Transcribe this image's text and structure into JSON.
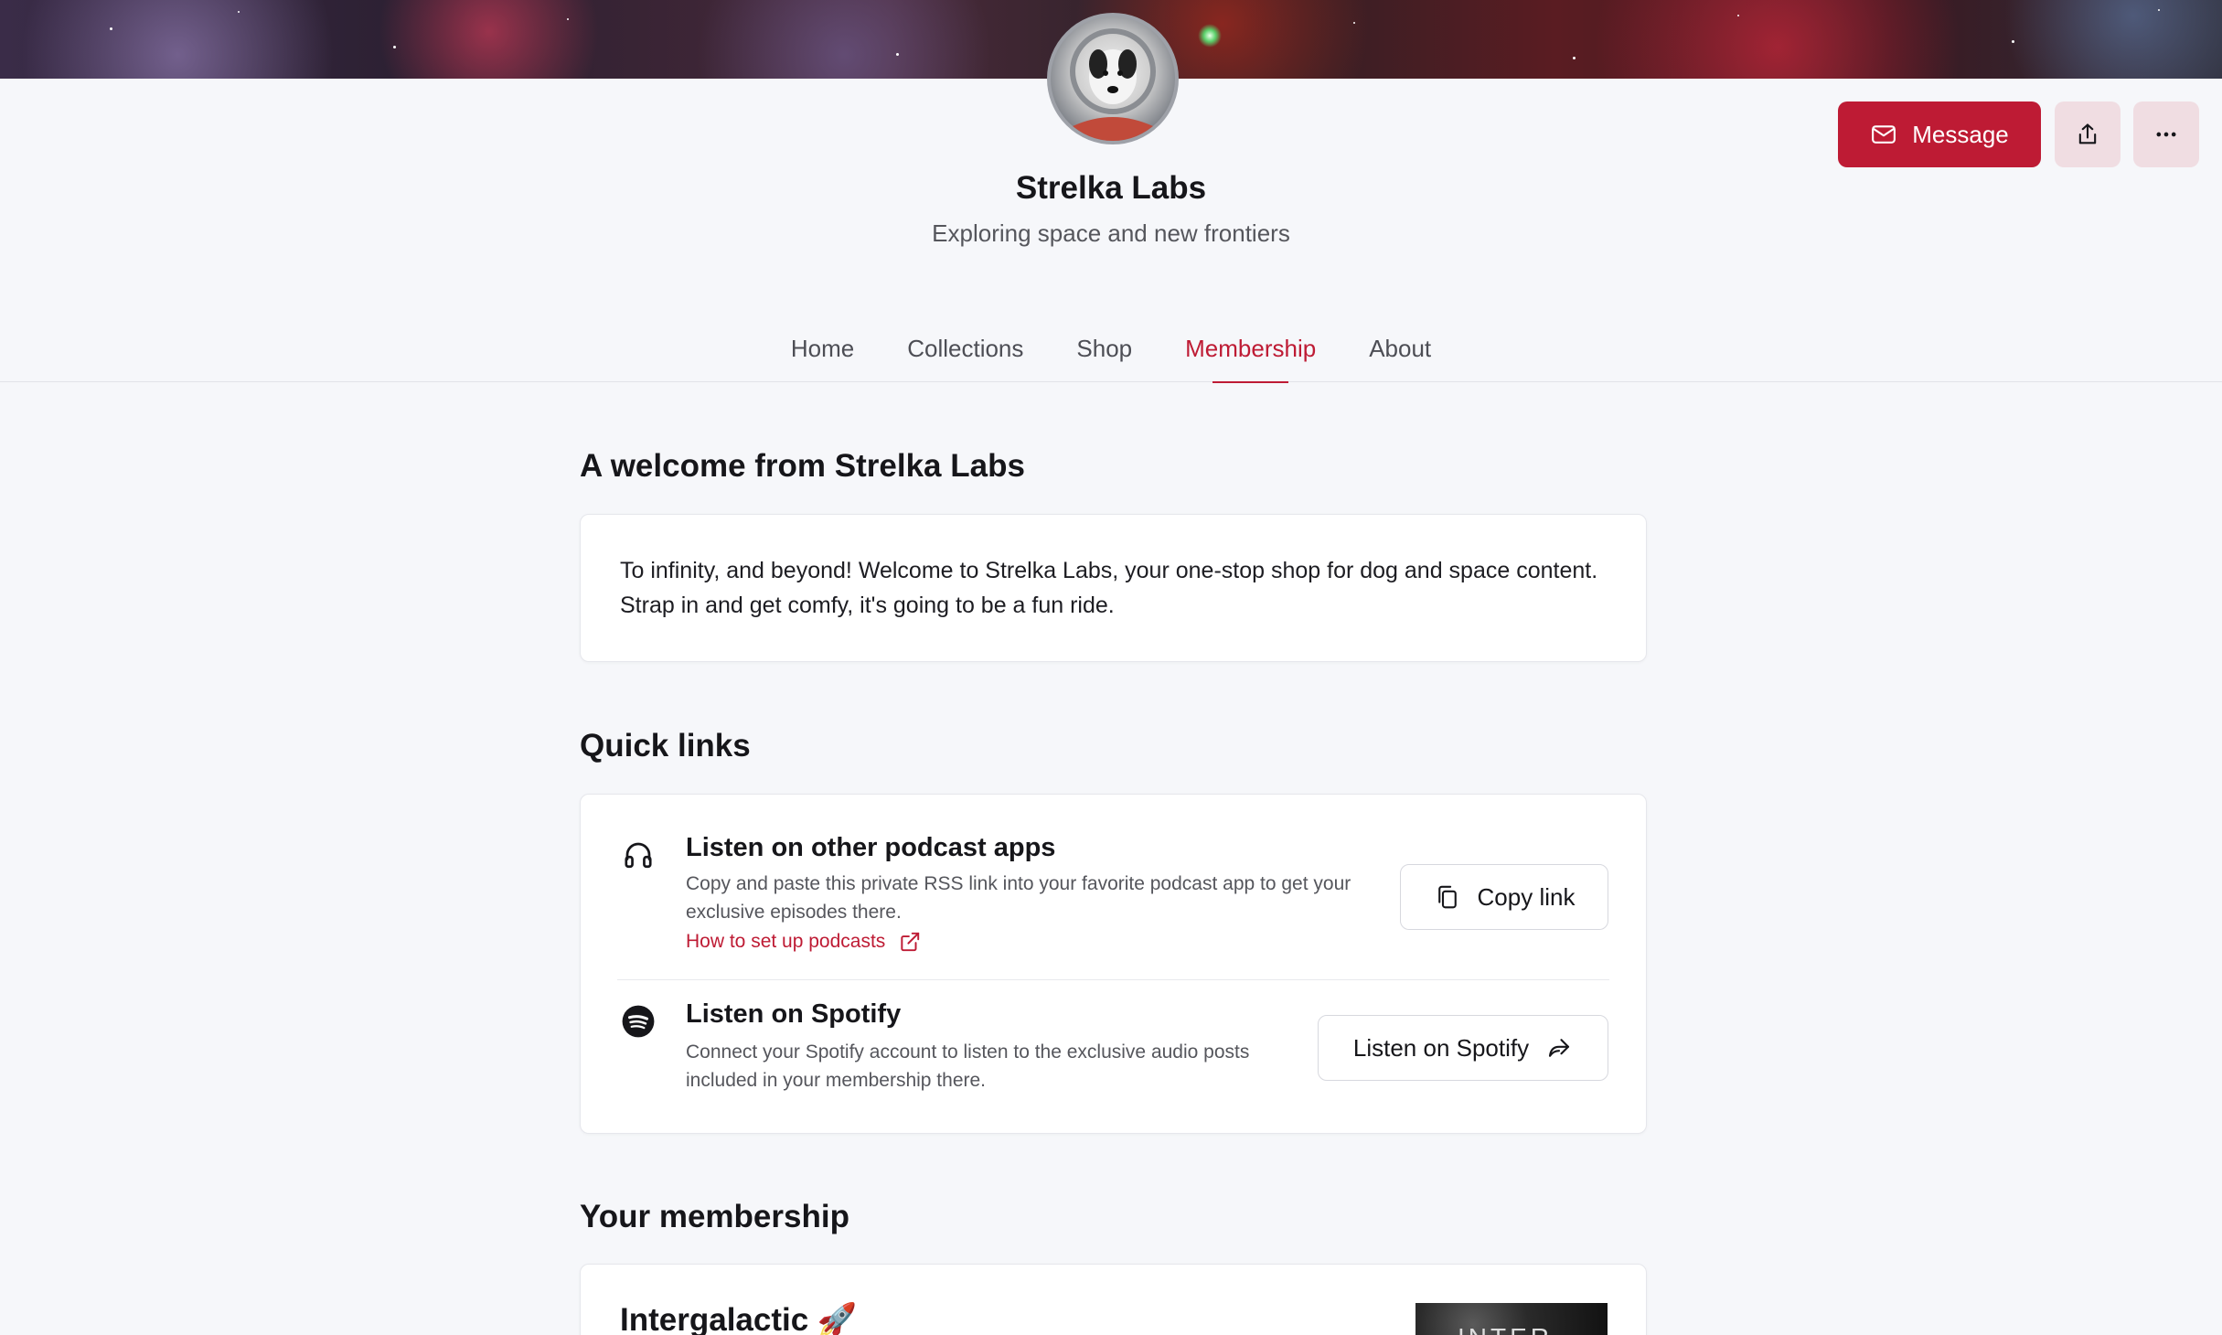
{
  "header": {
    "creator_name": "Strelka Labs",
    "tagline": "Exploring space and new frontiers",
    "message_label": "Message",
    "icons": {
      "message": "mail-icon",
      "share": "share-upload-icon",
      "more": "more-horizontal-icon"
    }
  },
  "tabs": [
    {
      "label": "Home",
      "active": false
    },
    {
      "label": "Collections",
      "active": false
    },
    {
      "label": "Shop",
      "active": false
    },
    {
      "label": "Membership",
      "active": true
    },
    {
      "label": "About",
      "active": false
    }
  ],
  "welcome": {
    "heading": "A welcome from Strelka Labs",
    "text": "To infinity, and beyond! Welcome to Strelka Labs, your one-stop shop for dog and space content. Strap in and get comfy, it's going to be a fun ride."
  },
  "quick_links": {
    "heading": "Quick links",
    "podcast": {
      "title": "Listen on other podcast apps",
      "description": "Copy and paste this private RSS link into your favorite podcast app to get your exclusive episodes there.",
      "link_label": "How to set up podcasts",
      "button_label": "Copy link",
      "icon": "headphones-icon"
    },
    "spotify": {
      "title": "Listen on Spotify",
      "description": "Connect your Spotify account to listen to the exclusive audio posts included in your membership there.",
      "button_label": "Listen on Spotify",
      "icon": "spotify-icon"
    }
  },
  "membership": {
    "heading": "Your membership",
    "tier_name": "Intergalactic 🚀",
    "thumb_text": "INTER"
  },
  "colors": {
    "accent": "#be1b34",
    "accent_soft": "#f0dde2",
    "background": "#f6f7fa",
    "card": "#ffffff"
  }
}
